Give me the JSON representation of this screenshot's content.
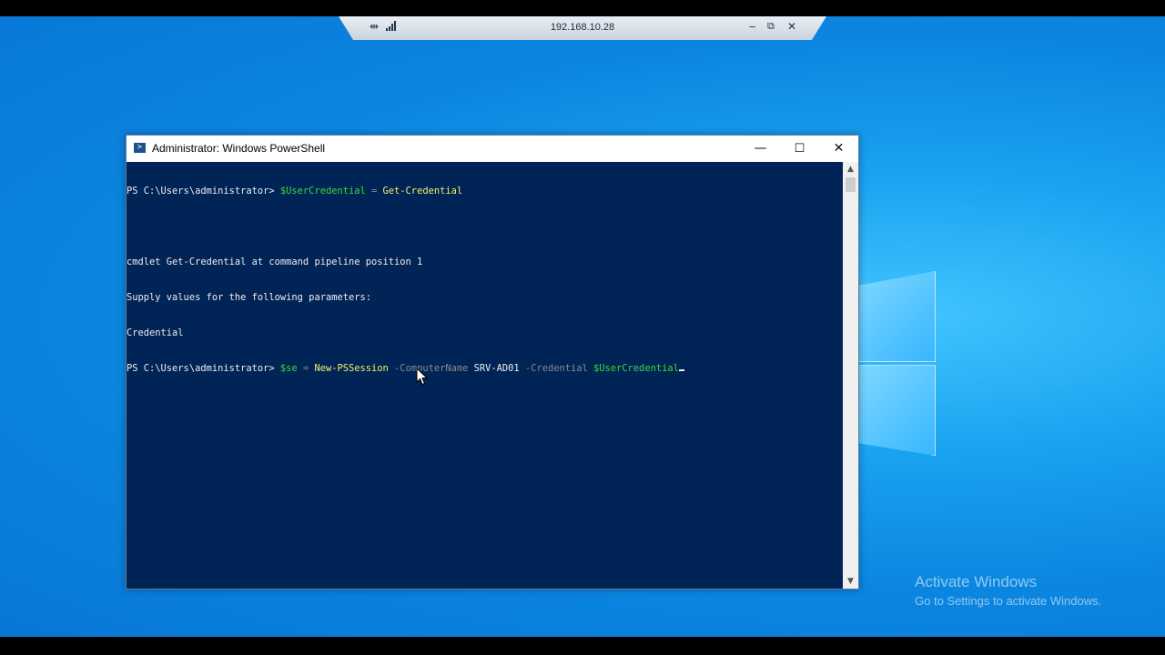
{
  "rdp_bar": {
    "address": "192.168.10.28",
    "pin_icon": "pin-icon",
    "signal_icon": "signal-icon",
    "minimize_icon": "minimize-icon",
    "restore_icon": "restore-icon",
    "close_icon": "close-icon"
  },
  "window": {
    "title": "Administrator: Windows PowerShell",
    "app_icon_glyph": ">",
    "minimize_glyph": "—",
    "maximize_glyph": "☐",
    "close_glyph": "✕"
  },
  "console": {
    "line1": {
      "prompt": "PS C:\\Users\\administrator> ",
      "var": "$UserCredential",
      "op": " = ",
      "cmd": "Get-Credential"
    },
    "line2": "",
    "line3": "cmdlet Get-Credential at command pipeline position 1",
    "line4": "Supply values for the following parameters:",
    "line5": "Credential",
    "line6": {
      "prompt": "PS C:\\Users\\administrator> ",
      "var": "$se",
      "op": " = ",
      "cmd": "New-PSSession",
      "param1": " -ComputerName ",
      "arg1": "SRV-AD01",
      "param2": " -Credential ",
      "var2": "$UserCredential"
    }
  },
  "watermark": {
    "title": "Activate Windows",
    "subtitle": "Go to Settings to activate Windows."
  },
  "colors": {
    "console_bg": "#012456",
    "variable": "#3bd93b",
    "command": "#f1f16b",
    "parameter": "#8a8a8a"
  }
}
